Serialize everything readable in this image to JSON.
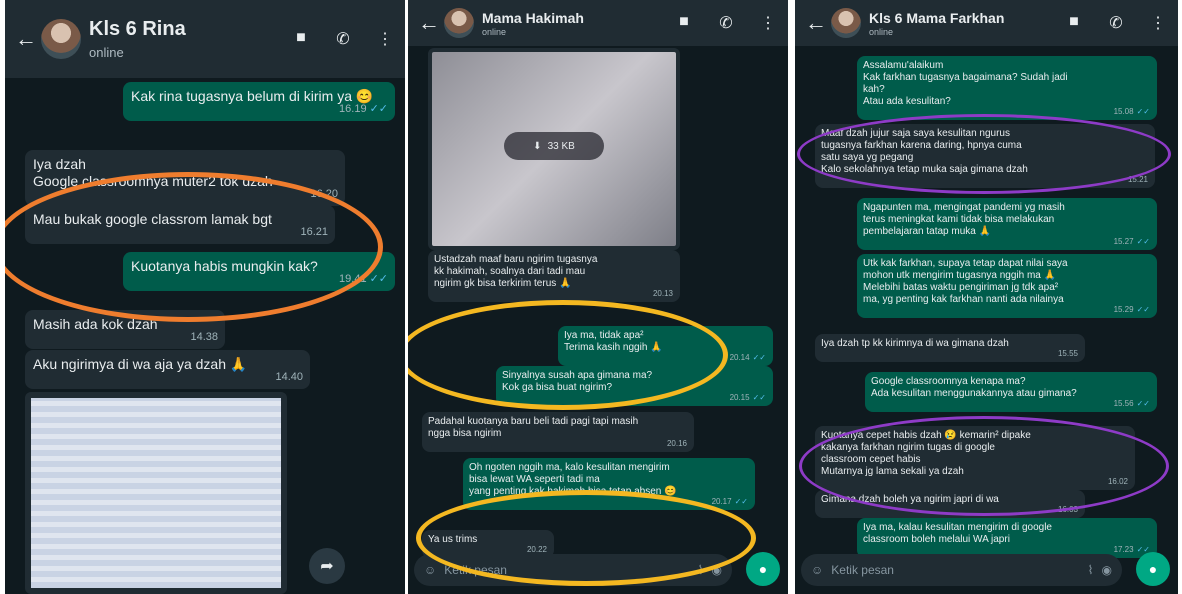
{
  "panels": [
    {
      "header": {
        "name": "Kls 6 Rina",
        "status": "online"
      },
      "messages": [
        {
          "text": "Kak rina tugasnya belum di kirim ya 😊",
          "time": "16.19"
        },
        {
          "text": "Iya dzah\nGoogle classroomnya muter2 tok dzah",
          "time": "16.20"
        },
        {
          "text": "Mau bukak google classrom lamak bgt",
          "time": "16.21"
        },
        {
          "text": "Kuotanya habis mungkin kak?",
          "time": "19.41"
        },
        {
          "text": "Masih ada kok dzah",
          "time": "14.38"
        },
        {
          "text": "Aku ngirimya di wa aja ya  dzah 🙏",
          "time": "14.40"
        }
      ]
    },
    {
      "header": {
        "name": "Mama Hakimah",
        "status": "online"
      },
      "download_size": "33 KB",
      "messages": [
        {
          "text": "Ustadzah maaf baru ngirim tugasnya\nkk hakimah, soalnya dari tadi mau\nngirim gk bisa terkirim terus 🙏",
          "time": "20.13"
        },
        {
          "text": "Iya ma, tidak apa²\nTerima kasih nggih 🙏",
          "time": "20.14"
        },
        {
          "text": "Sinyalnya susah apa gimana ma?\nKok ga bisa buat ngirim?",
          "time": "20.15"
        },
        {
          "text": "Padahal kuotanya baru beli tadi pagi tapi masih\nngga bisa ngirim",
          "time": "20.16"
        },
        {
          "text": "Oh ngoten nggih ma, kalo kesulitan mengirim\nbisa lewat WA seperti tadi ma\nyang penting kak hakimah bisa tetap absen 😊",
          "time": "20.17"
        },
        {
          "text": "Ya us trims",
          "time": "20.22"
        }
      ],
      "input_placeholder": "Ketik pesan"
    },
    {
      "header": {
        "name": "Kls 6 Mama Farkhan",
        "status": "online"
      },
      "messages": [
        {
          "text": "Assalamu'alaikum\nKak farkhan tugasnya bagaimana? Sudah jadi\nkah?\nAtau ada kesulitan?",
          "time": "15.08"
        },
        {
          "text": "Maaf dzah jujur saja saya kesulitan ngurus\ntugasnya farkhan karena daring, hpnya cuma\nsatu saya yg pegang\nKalo sekolahnya tetap muka saja gimana dzah",
          "time": "15.21"
        },
        {
          "text": "Ngapunten ma, mengingat pandemi yg masih\nterus meningkat kami tidak bisa melakukan\npembelajaran tatap muka 🙏",
          "time": "15.27"
        },
        {
          "text": "Utk kak farkhan, supaya tetap dapat nilai saya\nmohon utk mengirim tugasnya nggih ma 🙏\nMelebihi batas waktu pengiriman jg tdk apa²\nma, yg penting kak farkhan nanti ada nilainya",
          "time": "15.29"
        },
        {
          "text": "Iya dzah tp kk kirimnya di wa gimana dzah",
          "time": "15.55"
        },
        {
          "text": "Google classroomnya kenapa ma?\nAda kesulitan menggunakannya atau gimana?",
          "time": "15.56"
        },
        {
          "text": "Kuotanya cepet habis dzah 😢 kemarin² dipake\nkakanya farkhan ngirim tugas di google\nclassroom cepet habis\nMutarnya jg lama sekali ya dzah",
          "time": "16.02"
        },
        {
          "text": "Gimana dzah boleh ya ngirim japri di wa",
          "time": "16.03"
        },
        {
          "text": "Iya ma, kalau kesulitan mengirim di google\nclassroom boleh melalui WA japri",
          "time": "17.23"
        }
      ],
      "input_placeholder": "Ketik pesan"
    }
  ],
  "colors": {
    "annotation_orange": "#ef7d2e",
    "annotation_yellow": "#f4b821",
    "annotation_purple": "#8e3bc7",
    "outgoing_bubble": "#005c4b",
    "incoming_bubble": "#202c33"
  }
}
